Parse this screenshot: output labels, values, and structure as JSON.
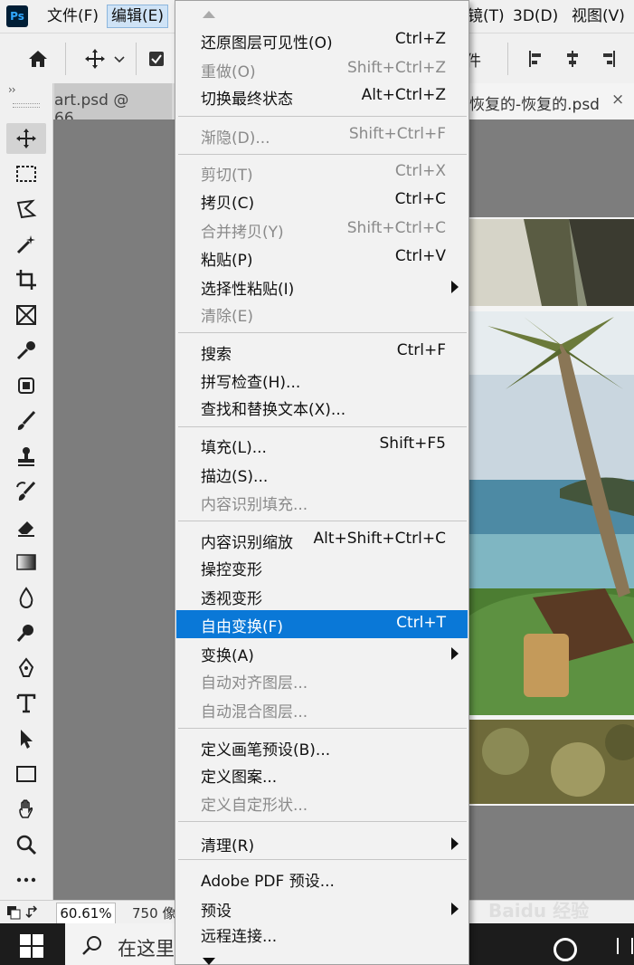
{
  "app": {
    "logo": "Ps"
  },
  "menubar": {
    "file": "文件(F)",
    "edit": "编辑(E)",
    "filter_partial": "镜(T)",
    "three_d": "3D(D)",
    "view": "视图(V)"
  },
  "options_bar": {
    "partial_text": "件"
  },
  "tabs": {
    "left": "art.psd @ 66....",
    "right": "恢复的-恢复的.psd",
    "close": "×"
  },
  "toolbar": {
    "collapse": "››"
  },
  "status": {
    "zoom": "60.61%",
    "doc_info": "750 像"
  },
  "taskbar": {
    "search_placeholder": "在这里"
  },
  "edit_menu": {
    "items": [
      {
        "label": "还原图层可见性(O)",
        "shortcut": "Ctrl+Z"
      },
      {
        "label": "重做(O)",
        "shortcut": "Shift+Ctrl+Z"
      },
      {
        "label": "切换最终状态",
        "shortcut": "Alt+Ctrl+Z"
      },
      {
        "label": "渐隐(D)...",
        "shortcut": "Shift+Ctrl+F"
      },
      {
        "label": "剪切(T)",
        "shortcut": "Ctrl+X"
      },
      {
        "label": "拷贝(C)",
        "shortcut": "Ctrl+C"
      },
      {
        "label": "合并拷贝(Y)",
        "shortcut": "Shift+Ctrl+C"
      },
      {
        "label": "粘贴(P)",
        "shortcut": "Ctrl+V"
      },
      {
        "label": "选择性粘贴(I)"
      },
      {
        "label": "清除(E)"
      },
      {
        "label": "搜索",
        "shortcut": "Ctrl+F"
      },
      {
        "label": "拼写检查(H)..."
      },
      {
        "label": "查找和替换文本(X)..."
      },
      {
        "label": "填充(L)...",
        "shortcut": "Shift+F5"
      },
      {
        "label": "描边(S)..."
      },
      {
        "label": "内容识别填充..."
      },
      {
        "label": "内容识别缩放",
        "shortcut": "Alt+Shift+Ctrl+C"
      },
      {
        "label": "操控变形"
      },
      {
        "label": "透视变形"
      },
      {
        "label": "自由变换(F)",
        "shortcut": "Ctrl+T"
      },
      {
        "label": "变换(A)"
      },
      {
        "label": "自动对齐图层..."
      },
      {
        "label": "自动混合图层..."
      },
      {
        "label": "定义画笔预设(B)..."
      },
      {
        "label": "定义图案..."
      },
      {
        "label": "定义自定形状..."
      },
      {
        "label": "清理(R)"
      },
      {
        "label": "Adobe PDF 预设..."
      },
      {
        "label": "预设"
      },
      {
        "label": "远程连接..."
      }
    ]
  },
  "watermark": "Baidu 经验",
  "colors": {
    "highlight": "#0a78d7",
    "disabled_text": "#8a8a8a",
    "menu_bg": "#f2f2f2",
    "ps_logo_bg": "#001e36",
    "ps_logo_fg": "#31a8ff"
  }
}
